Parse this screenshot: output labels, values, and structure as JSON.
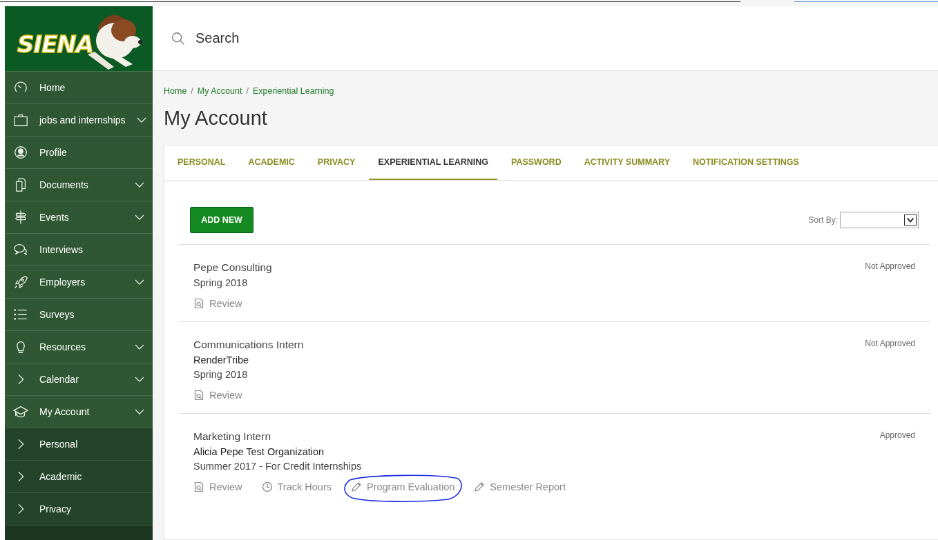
{
  "logo": {
    "text": "SIENA"
  },
  "sidebar": {
    "items": [
      {
        "label": "Home",
        "has_submenu": false
      },
      {
        "label": "jobs and internships",
        "has_submenu": true
      },
      {
        "label": "Profile",
        "has_submenu": false
      },
      {
        "label": "Documents",
        "has_submenu": true
      },
      {
        "label": "Events",
        "has_submenu": true
      },
      {
        "label": "Interviews",
        "has_submenu": false
      },
      {
        "label": "Employers",
        "has_submenu": true
      },
      {
        "label": "Surveys",
        "has_submenu": false
      },
      {
        "label": "Resources",
        "has_submenu": true
      },
      {
        "label": "Calendar",
        "has_submenu": true
      },
      {
        "label": "My Account",
        "has_submenu": true,
        "expanded": true,
        "children": [
          {
            "label": "Personal"
          },
          {
            "label": "Academic"
          },
          {
            "label": "Privacy"
          }
        ]
      }
    ]
  },
  "search": {
    "placeholder": "Search"
  },
  "breadcrumb": [
    {
      "kind": "link",
      "label": "Home"
    },
    {
      "kind": "separator",
      "label": "/"
    },
    {
      "kind": "link",
      "label": "My Account"
    },
    {
      "kind": "separator",
      "label": "/"
    },
    {
      "kind": "link",
      "label": "Experiential Learning"
    }
  ],
  "page_title": "My Account",
  "tabs": [
    {
      "label": "PERSONAL",
      "selected": false
    },
    {
      "label": "ACADEMIC",
      "selected": false
    },
    {
      "label": "PRIVACY",
      "selected": false
    },
    {
      "label": "EXPERIENTIAL LEARNING",
      "selected": true
    },
    {
      "label": "PASSWORD",
      "selected": false
    },
    {
      "label": "ACTIVITY SUMMARY",
      "selected": false
    },
    {
      "label": "NOTIFICATION SETTINGS",
      "selected": false
    }
  ],
  "add_button": "ADD NEW",
  "sort": {
    "label": "Sort By:"
  },
  "entries": [
    {
      "title": "Pepe Consulting",
      "lines": [
        "Spring 2018"
      ],
      "status": "Not Approved",
      "actions": [
        {
          "label": "Review",
          "kind": "review",
          "circled": false
        }
      ]
    },
    {
      "title": "Communications Intern",
      "lines": [
        "RenderTribe",
        "Spring 2018"
      ],
      "status": "Not Approved",
      "actions": [
        {
          "label": "Review",
          "kind": "review",
          "circled": false
        }
      ]
    },
    {
      "title": "Marketing Intern",
      "lines": [
        "Alicia Pepe Test Organization",
        "Summer 2017 - For Credit Internships"
      ],
      "status": "Approved",
      "actions": [
        {
          "label": "Review",
          "kind": "review",
          "circled": false
        },
        {
          "label": "Track Hours",
          "kind": "hours",
          "circled": false
        },
        {
          "label": "Program Evaluation",
          "kind": "evaluation",
          "circled": true
        },
        {
          "label": "Semester Report",
          "kind": "report",
          "circled": false
        }
      ]
    }
  ]
}
